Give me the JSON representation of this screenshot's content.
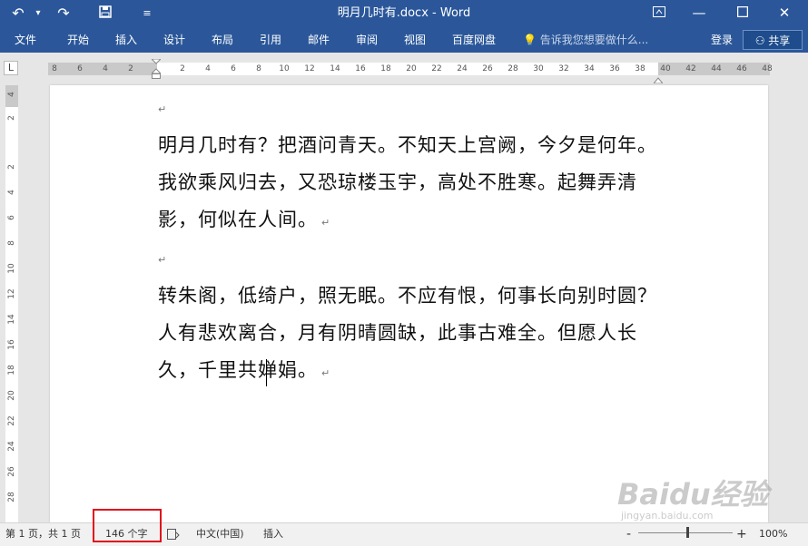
{
  "window": {
    "title": "明月几时有.docx - Word",
    "quick_access": [
      "undo-icon",
      "redo-icon",
      "save-icon",
      "customize-icon"
    ],
    "controls": [
      "ribbon-display-icon",
      "minimize-icon",
      "restore-icon",
      "close-icon"
    ]
  },
  "ribbon": {
    "tabs": [
      "文件",
      "开始",
      "插入",
      "设计",
      "布局",
      "引用",
      "邮件",
      "审阅",
      "视图",
      "百度网盘"
    ],
    "tell_me": "告诉我您想要做什么...",
    "login": "登录",
    "share": "共享"
  },
  "rulers": {
    "corner": "L",
    "h_ticks": [
      "8",
      "6",
      "4",
      "2",
      "2",
      "4",
      "6",
      "8",
      "10",
      "12",
      "14",
      "16",
      "18",
      "20",
      "22",
      "24",
      "26",
      "28",
      "30",
      "32",
      "34",
      "36",
      "38",
      "40",
      "42",
      "44",
      "46",
      "48"
    ],
    "v_ticks": [
      "4",
      "2",
      "2",
      "4",
      "6",
      "8",
      "10",
      "12",
      "14",
      "16",
      "18",
      "20",
      "22",
      "24",
      "26",
      "28"
    ]
  },
  "document": {
    "paragraph_mark": "↵",
    "para1": "明月几时有？把酒问青天。不知天上宫阙，今夕是何年。我欲乘风归去，又恐琼楼玉宇，高处不胜寒。起舞弄清影，何似在人间。",
    "para2": "转朱阁，低绮户，照无眠。不应有恨，何事长向别时圆？人有悲欢离合，月有阴晴圆缺，此事古难全。但愿人长久，千里共婵娟。"
  },
  "status": {
    "page": "第 1 页，共 1 页",
    "word_count": "146 个字",
    "language": "中文(中国)",
    "mode": "插入",
    "zoom": "100%",
    "zoom_minus": "-",
    "zoom_plus": "+"
  },
  "watermark": {
    "brand": "Baidu经验",
    "url": "jingyan.baidu.com"
  },
  "colors": {
    "ribbon": "#2b579a",
    "highlight": "#e0101a"
  }
}
